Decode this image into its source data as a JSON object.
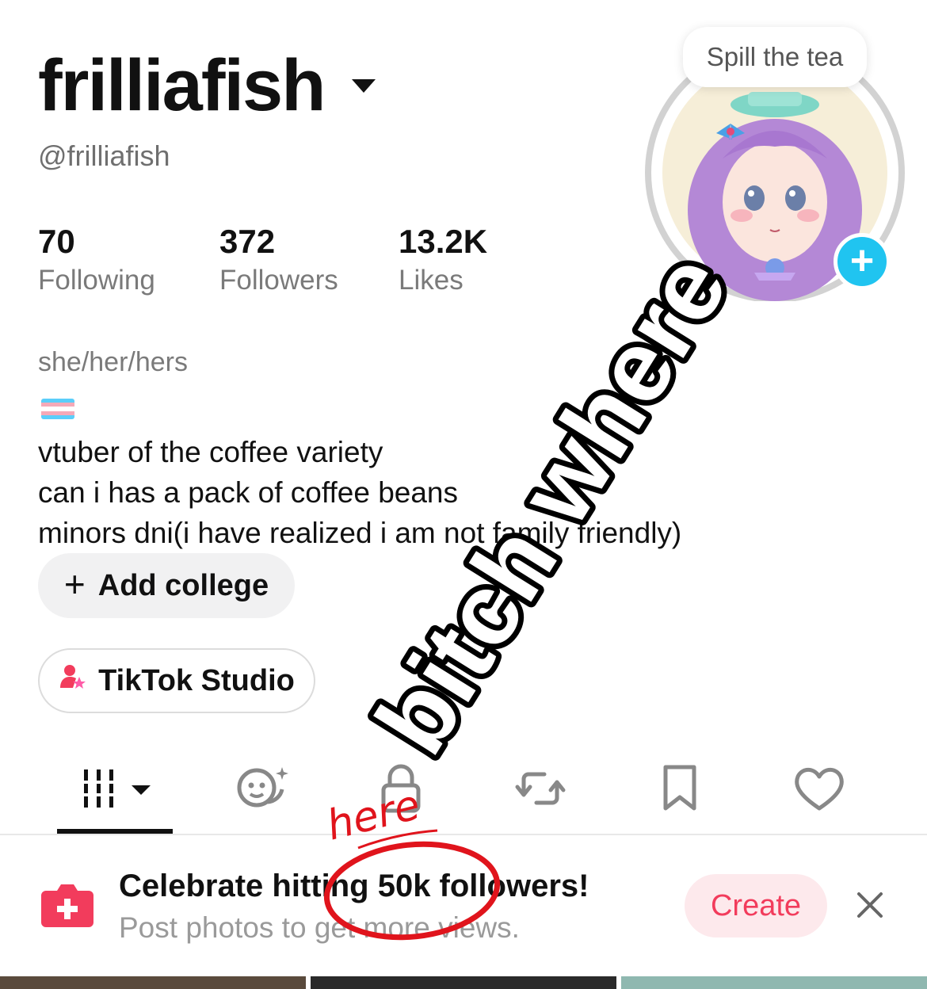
{
  "profile": {
    "username": "frilliafish",
    "handle": "@frilliafish",
    "stats": [
      {
        "value": "70",
        "label": "Following"
      },
      {
        "value": "372",
        "label": "Followers"
      },
      {
        "value": "13.2K",
        "label": "Likes"
      }
    ],
    "pronouns": "she/her/hers",
    "bio_lines": [
      "vtuber of the coffee variety",
      "can i has a pack of coffee beans",
      "minors dni(i have realized i am not family friendly)"
    ],
    "add_college_label": "Add college",
    "studio_label": "TikTok Studio",
    "tooltip": "Spill the tea"
  },
  "tabs": [
    {
      "icon": "grid-icon",
      "active": true
    },
    {
      "icon": "reposts-face-icon"
    },
    {
      "icon": "lock-icon"
    },
    {
      "icon": "repost-icon"
    },
    {
      "icon": "bookmark-icon"
    },
    {
      "icon": "heart-icon"
    }
  ],
  "promo": {
    "title": "Celebrate hitting 50k followers!",
    "subtitle": "Post photos to get more views.",
    "create_label": "Create"
  },
  "annotations": {
    "big_text": "bitch where",
    "small_text": "here"
  },
  "colors": {
    "accent": "#f23c5c",
    "plus_badge": "#20c4f0",
    "annotation_red": "#e0141c"
  }
}
